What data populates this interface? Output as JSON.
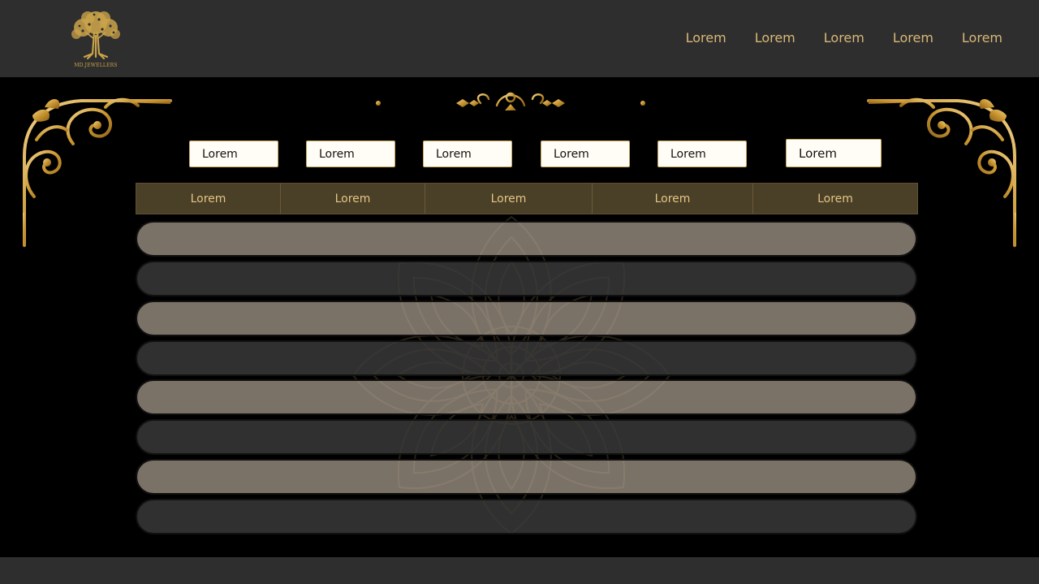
{
  "brand": {
    "logo_icon": "tree-logo-icon",
    "name": "MD.JEWELLERS",
    "colors": {
      "gold": "#c9a24a",
      "nav_text": "#d9b877",
      "header_bg": "#2e2e2e"
    }
  },
  "nav": {
    "items": [
      {
        "label": "Lorem"
      },
      {
        "label": "Lorem"
      },
      {
        "label": "Lorem"
      },
      {
        "label": "Lorem"
      },
      {
        "label": "Lorem"
      }
    ]
  },
  "filters": [
    {
      "value": "Lorem"
    },
    {
      "value": "Lorem"
    },
    {
      "value": "Lorem"
    },
    {
      "value": "Lorem"
    },
    {
      "value": "Lorem"
    },
    {
      "value": "Lorem"
    }
  ],
  "table": {
    "headers": [
      "Lorem",
      "Lorem",
      "Lorem",
      "Lorem",
      "Lorem"
    ],
    "rows": [
      {
        "style": "light"
      },
      {
        "style": "dark"
      },
      {
        "style": "light"
      },
      {
        "style": "dark"
      },
      {
        "style": "light"
      },
      {
        "style": "dark"
      },
      {
        "style": "light"
      },
      {
        "style": "dark"
      }
    ]
  },
  "decorations": {
    "corner": "ornamental-corner-icon",
    "divider": "ornamental-divider-icon",
    "background": "mandala-watermark-icon"
  }
}
